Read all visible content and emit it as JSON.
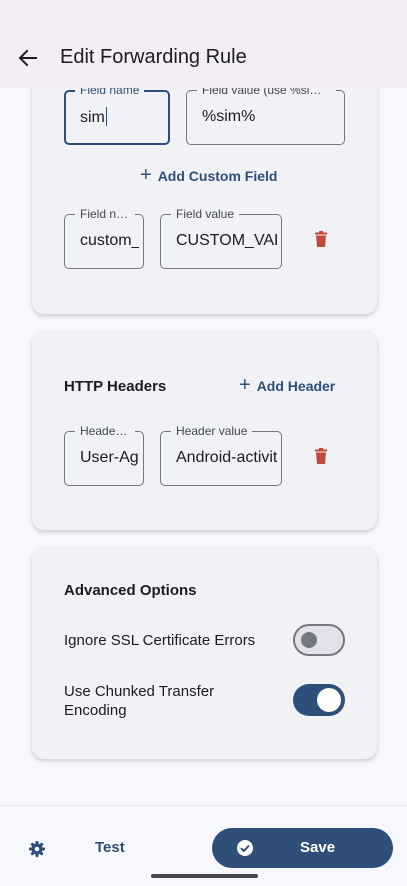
{
  "appbar": {
    "title": "Edit Forwarding Rule"
  },
  "custom_fields": {
    "active_field": {
      "name_label": "Field name",
      "name_value": "sim",
      "value_label": "Field value (use %sim% for SIM number)",
      "value_value": "%sim%"
    },
    "add_button_label": "Add Custom Field",
    "rows": [
      {
        "name_label": "Field name",
        "name_value": "custom_field",
        "value_label": "Field value",
        "value_value": "CUSTOM_VALUE"
      }
    ]
  },
  "http_headers": {
    "title": "HTTP Headers",
    "add_button_label": "Add Header",
    "rows": [
      {
        "name_label": "Header name",
        "name_value": "User-Agent",
        "value_label": "Header value",
        "value_value": "Android-activity"
      }
    ]
  },
  "advanced": {
    "title": "Advanced Options",
    "options": [
      {
        "label": "Ignore SSL Certificate Errors",
        "enabled": false
      },
      {
        "label": "Use Chunked Transfer Encoding",
        "enabled": true
      }
    ]
  },
  "bottom_bar": {
    "test_label": "Test",
    "save_label": "Save"
  },
  "icons": {
    "back": "arrow-back-icon",
    "add": "plus-icon",
    "delete": "trash-icon",
    "settings": "gear-icon",
    "save": "check-circle-icon"
  },
  "colors": {
    "primary": "#2f4f7a",
    "danger": "#c0483c",
    "card": "#f0f2f6",
    "appbar": "#f3eef3"
  }
}
